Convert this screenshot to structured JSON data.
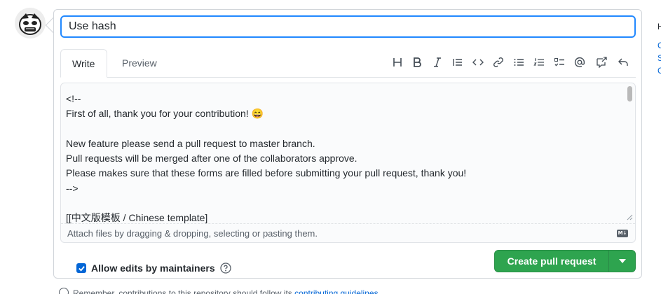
{
  "pr_title": {
    "value": "Use hash"
  },
  "tabs": [
    {
      "label": "Write",
      "active": true
    },
    {
      "label": "Preview",
      "active": false
    }
  ],
  "toolbar": {
    "icons": [
      "heading-icon",
      "bold-icon",
      "italic-icon",
      "quote-icon",
      "code-icon",
      "link-icon",
      "unordered-list-icon",
      "ordered-list-icon",
      "task-list-icon",
      "mention-icon",
      "reference-icon",
      "reply-icon"
    ]
  },
  "editor": {
    "lines": [
      "<!--",
      "First of all, thank you for your contribution! 😄",
      "",
      "New feature please send a pull request to master branch.",
      "Pull requests will be merged after one of the collaborators approve.",
      "Please makes sure that these forms are filled before submitting your pull request, thank you!",
      "-->",
      "",
      "[[中文版模板 / Chinese template]"
    ],
    "attach_hint": "Attach files by dragging & dropping, selecting or pasting them.",
    "markdown_badge": "M↓"
  },
  "options": {
    "allow_edits_label": "Allow edits by maintainers",
    "allow_edits_checked": true
  },
  "submit": {
    "label": "Create pull request"
  },
  "sidebar": {
    "heading": "H",
    "links": [
      "C",
      "S",
      "C"
    ]
  },
  "footer": {
    "text": "Remember, contributions to this repository should follow its ",
    "link": "contributing guidelines"
  },
  "colors": {
    "accent": "#0366d6",
    "focus_border": "#2188ff",
    "primary_button": "#2ea44f"
  }
}
